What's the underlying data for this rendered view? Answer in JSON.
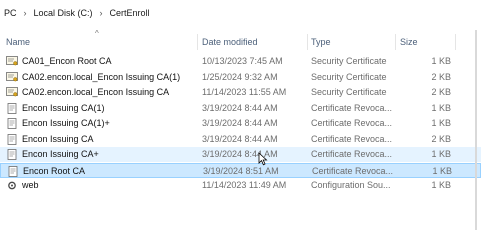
{
  "breadcrumb": {
    "items": [
      "PC",
      "Local Disk (C:)",
      "CertEnroll"
    ],
    "separator": "›"
  },
  "columns": {
    "name": "Name",
    "date": "Date modified",
    "type": "Type",
    "size": "Size"
  },
  "files": [
    {
      "name": "CA01_Encon Root CA",
      "date": "10/13/2023 7:45 AM",
      "type": "Security Certificate",
      "size": "1 KB",
      "icon": "certificate-icon"
    },
    {
      "name": "CA02.encon.local_Encon Issuing CA(1)",
      "date": "1/25/2024 9:32 AM",
      "type": "Security Certificate",
      "size": "2 KB",
      "icon": "certificate-icon"
    },
    {
      "name": "CA02.encon.local_Encon Issuing CA",
      "date": "11/14/2023 11:55 AM",
      "type": "Security Certificate",
      "size": "2 KB",
      "icon": "certificate-icon"
    },
    {
      "name": "Encon Issuing CA(1)",
      "date": "3/19/2024 8:44 AM",
      "type": "Certificate Revoca...",
      "size": "1 KB",
      "icon": "crl-icon"
    },
    {
      "name": "Encon Issuing CA(1)+",
      "date": "3/19/2024 8:44 AM",
      "type": "Certificate Revoca...",
      "size": "1 KB",
      "icon": "crl-icon"
    },
    {
      "name": "Encon Issuing CA",
      "date": "3/19/2024 8:44 AM",
      "type": "Certificate Revoca...",
      "size": "2 KB",
      "icon": "crl-icon"
    },
    {
      "name": "Encon Issuing CA+",
      "date": "3/19/2024 8:44 AM",
      "type": "Certificate Revoca...",
      "size": "1 KB",
      "icon": "crl-icon"
    },
    {
      "name": "Encon Root CA",
      "date": "3/19/2024 8:51 AM",
      "type": "Certificate Revoca...",
      "size": "1 KB",
      "icon": "crl-icon"
    },
    {
      "name": "web",
      "date": "11/14/2023 11:49 AM",
      "type": "Configuration Sou...",
      "size": "1 KB",
      "icon": "config-file-icon"
    }
  ],
  "hovered_index": 6,
  "selected_index": 7,
  "colors": {
    "hover": "#e5f3ff",
    "selected": "#cce8ff",
    "selected_border": "#99d1ff"
  }
}
